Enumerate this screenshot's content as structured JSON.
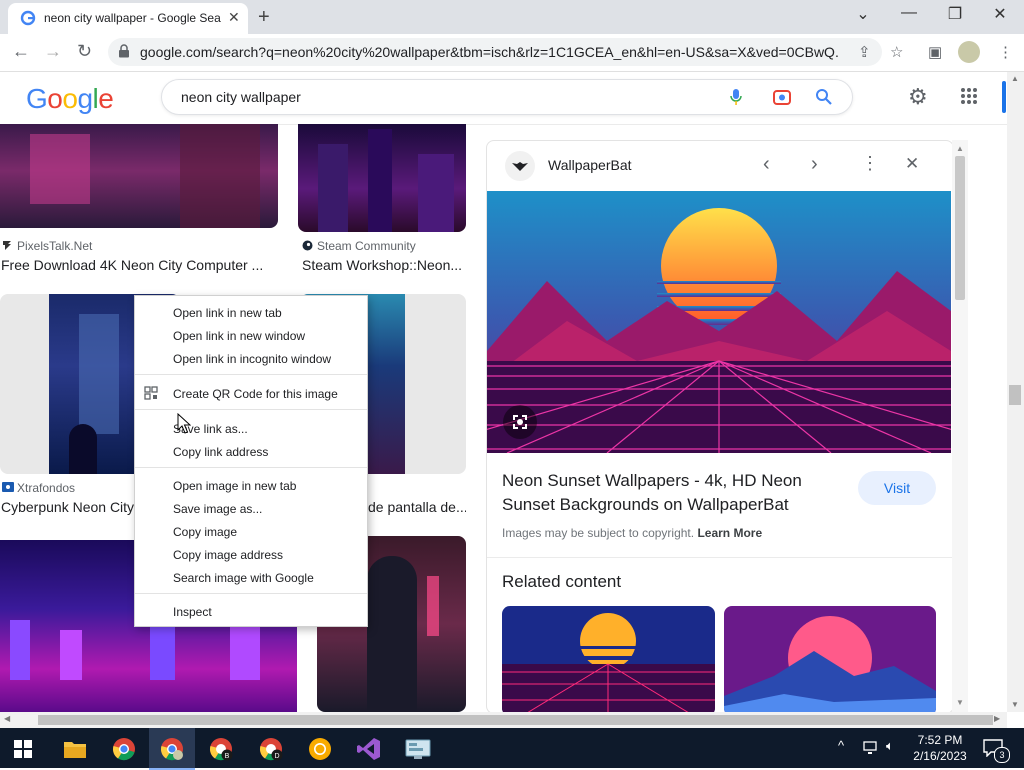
{
  "browser": {
    "tab_title": "neon city wallpaper - Google Sea",
    "url": "google.com/search?q=neon%20city%20wallpaper&tbm=isch&rlz=1C1GCEA_en&hl=en-US&sa=X&ved=0CBwQ..."
  },
  "google": {
    "logo": "Google",
    "query": "neon city wallpaper"
  },
  "results": [
    {
      "source": "PixelsTalk.Net",
      "title": "Free Download 4K Neon City Computer ..."
    },
    {
      "source": "Steam Community",
      "title": "Steam Workshop::Neon..."
    },
    {
      "source": "Xtrafondos",
      "title": "Cyberpunk Neon City"
    },
    {
      "source": "",
      "title": "de pantalla de..."
    }
  ],
  "panel": {
    "site": "WallpaperBat",
    "title_line1": "Neon Sunset Wallpapers - 4k, HD Neon",
    "title_line2": "Sunset Backgrounds on WallpaperBat",
    "visit_label": "Visit",
    "copyright": "Images may be subject to copyright.",
    "learn_more": "Learn More",
    "related_heading": "Related content"
  },
  "context_menu": {
    "group1": [
      "Open link in new tab",
      "Open link in new window",
      "Open link in incognito window"
    ],
    "qr": "Create QR Code for this image",
    "group2": [
      "Save link as...",
      "Copy link address"
    ],
    "group3": [
      "Open image in new tab",
      "Save image as...",
      "Copy image",
      "Copy image address",
      "Search image with Google"
    ],
    "inspect": "Inspect"
  },
  "taskbar": {
    "time": "7:52 PM",
    "date": "2/16/2023",
    "notifications": "3"
  },
  "colors": {
    "google_blue": "#4285f4",
    "google_red": "#ea4335",
    "google_yellow": "#fbbc05",
    "google_green": "#34a853",
    "visit_bg": "#e8f0fe",
    "visit_text": "#1a73e8"
  }
}
